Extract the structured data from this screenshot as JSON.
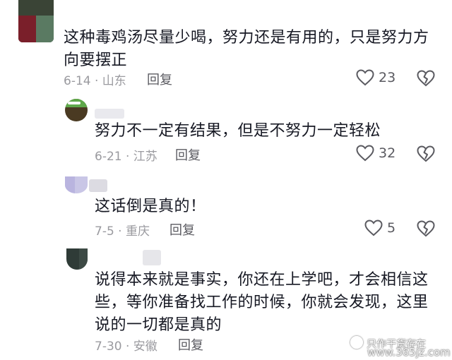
{
  "colors": {
    "text": "#161823",
    "meta": "#9a9a9f",
    "reply": "#5a5a60",
    "icon": "#5a5a60"
  },
  "comments": [
    {
      "text": "这种毒鸡汤尽量少喝，努力还是有用的，只是努力方向要摆正",
      "date_location": "6-14 · 山东",
      "reply_label": "回复",
      "likes": "23"
    },
    {
      "text": "努力不一定有结果，但是不努力一定轻松",
      "date_location": "6-21 · 江苏",
      "reply_label": "回复",
      "likes": "32"
    },
    {
      "text": "这话倒是真的！",
      "date_location": "7-5 · 重庆",
      "reply_label": "回复",
      "likes": "5"
    },
    {
      "text": "说得本来就是事实，你还在上学吧，才会相信这些，等你准备找工作的时候，你就会发现，这里说的一切都是真的",
      "date_location": "7-30 · 安徽",
      "reply_label": "回复"
    }
  ],
  "watermark": "www.365jz.com",
  "watermark_prefix": "只作干货存在"
}
